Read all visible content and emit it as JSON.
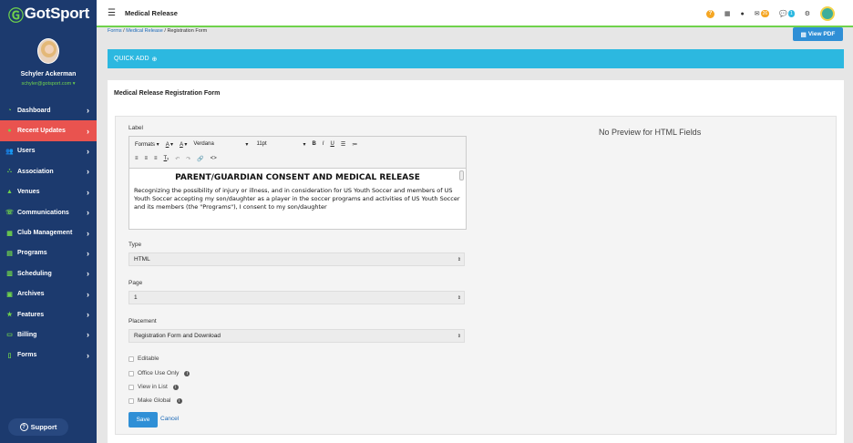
{
  "app": {
    "logo_text": "GotSport"
  },
  "profile": {
    "name": "Schyler Ackerman",
    "email": "schyler@gotsport.com ▾"
  },
  "nav": [
    {
      "label": "Dashboard",
      "icon": "dashboard-icon",
      "glyph": "◔"
    },
    {
      "label": "Recent Updates",
      "icon": "updates-icon",
      "glyph": "●"
    },
    {
      "label": "Users",
      "icon": "users-icon",
      "glyph": "👥"
    },
    {
      "label": "Association",
      "icon": "association-icon",
      "glyph": "⛬"
    },
    {
      "label": "Venues",
      "icon": "venues-icon",
      "glyph": "▲"
    },
    {
      "label": "Communications",
      "icon": "communications-icon",
      "glyph": "☏"
    },
    {
      "label": "Club Management",
      "icon": "club-management-icon",
      "glyph": "▦"
    },
    {
      "label": "Programs",
      "icon": "programs-icon",
      "glyph": "▤"
    },
    {
      "label": "Scheduling",
      "icon": "scheduling-icon",
      "glyph": "▥"
    },
    {
      "label": "Archives",
      "icon": "archives-icon",
      "glyph": "▣"
    },
    {
      "label": "Features",
      "icon": "features-icon",
      "glyph": "★"
    },
    {
      "label": "Billing",
      "icon": "billing-icon",
      "glyph": "▭"
    },
    {
      "label": "Forms",
      "icon": "forms-icon",
      "glyph": "▯"
    }
  ],
  "active_nav": "Recent Updates",
  "support": {
    "label": "Support"
  },
  "topbar": {
    "title": "Medical Release",
    "mail_count": "26",
    "chat_count": "1"
  },
  "breadcrumb": {
    "items": [
      "Forms",
      "Medical Release",
      "Registration Form"
    ],
    "sep": "/"
  },
  "view_pdf": "View PDF",
  "quick_add": "QUICK ADD",
  "form": {
    "title": "Medical Release Registration Form",
    "label_field": "Label",
    "toolbar": {
      "formats": "Formats",
      "font": "Verdana",
      "size": "11pt"
    },
    "editor": {
      "heading": "PARENT/GUARDIAN CONSENT AND MEDICAL RELEASE",
      "body": "Recognizing the possibility of injury or illness, and in consideration for US Youth Soccer and members of US Youth Soccer accepting my son/daughter as a player in the soccer programs and activities of US Youth Soccer and its members (the \"Programs\"), I consent to my son/daughter"
    },
    "type_label": "Type",
    "type_value": "HTML",
    "page_label": "Page",
    "page_value": "1",
    "placement_label": "Placement",
    "placement_value": "Registration Form and Download",
    "checkboxes": [
      {
        "label": "Editable",
        "info": false
      },
      {
        "label": "Office Use Only",
        "info": true
      },
      {
        "label": "View in List",
        "info": true
      },
      {
        "label": "Make Global",
        "info": true
      }
    ],
    "save": "Save",
    "cancel": "Cancel",
    "preview_text": "No Preview for HTML Fields"
  },
  "colors": {
    "sidebar": "#1c3a6e",
    "accent_green": "#6fd24c",
    "active": "#e9534f",
    "quick_add": "#2cb8e0",
    "button_blue": "#2f8fd6"
  }
}
